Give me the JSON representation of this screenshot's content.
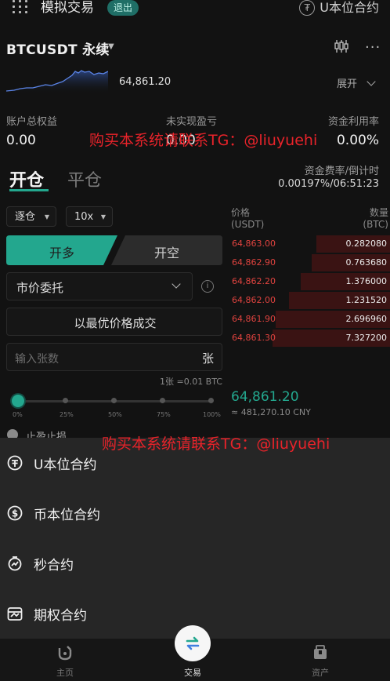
{
  "header": {
    "app_title": "模拟交易",
    "exit_label": "退出",
    "contract_switch": "U本位合约",
    "tether_glyph": "₮"
  },
  "pair": {
    "symbol": "BTCUSDT 永续",
    "price": "64,861.20",
    "expand_label": "展开"
  },
  "account": {
    "total_equity_label": "账户总权益",
    "total_equity_value": "0.00",
    "unrealized_pnl_label": "未实现盈亏",
    "unrealized_pnl_value": "0.00",
    "margin_usage_label": "资金利用率",
    "margin_usage_value": "0.00%"
  },
  "watermark": "购买本系统请联系TG：@liuyuehi",
  "tabs": {
    "open": "开仓",
    "close": "平仓"
  },
  "funding": {
    "label": "资金费率/倒计时",
    "value": "0.00197%/06:51:23"
  },
  "order_form": {
    "margin_mode": "逐仓",
    "leverage": "10x",
    "long_label": "开多",
    "short_label": "开空",
    "order_type": "市价委托",
    "info_glyph": "i",
    "best_price_label": "以最优价格成交",
    "qty_placeholder": "输入张数",
    "qty_unit": "张",
    "contract_size": "1张 =0.01 BTC",
    "slider_value_pct": 0,
    "slider_ticks": [
      "0%",
      "25%",
      "50%",
      "75%",
      "100%"
    ],
    "tp_sl_label": "止盈止损"
  },
  "orderbook": {
    "price_header": "价格",
    "price_unit": "(USDT)",
    "qty_header": "数量",
    "qty_unit": "(BTC)",
    "asks": [
      {
        "price": "64,863.00",
        "qty": "0.282080",
        "depth": 0.45
      },
      {
        "price": "64,862.90",
        "qty": "0.763680",
        "depth": 0.48
      },
      {
        "price": "64,862.20",
        "qty": "1.376000",
        "depth": 0.55
      },
      {
        "price": "64,862.00",
        "qty": "1.231520",
        "depth": 0.62
      },
      {
        "price": "64,861.90",
        "qty": "2.696960",
        "depth": 0.7
      },
      {
        "price": "64,861.30",
        "qty": "7.327200",
        "depth": 0.72
      }
    ],
    "last_price": "64,861.20",
    "last_price_cny": "≈ 481,270.10 CNY"
  },
  "sheet": {
    "items": [
      {
        "label": "U本位合约",
        "icon": "tether-coin-icon"
      },
      {
        "label": "币本位合约",
        "icon": "dollar-coin-icon"
      },
      {
        "label": "秒合约",
        "icon": "stopwatch-icon"
      },
      {
        "label": "期权合约",
        "icon": "options-chart-icon"
      }
    ]
  },
  "nav": {
    "home": "主页",
    "trade": "交易",
    "assets": "资产"
  },
  "colors": {
    "accent": "#23a78e",
    "sell": "#e0433f",
    "watermark": "#e8232a"
  }
}
